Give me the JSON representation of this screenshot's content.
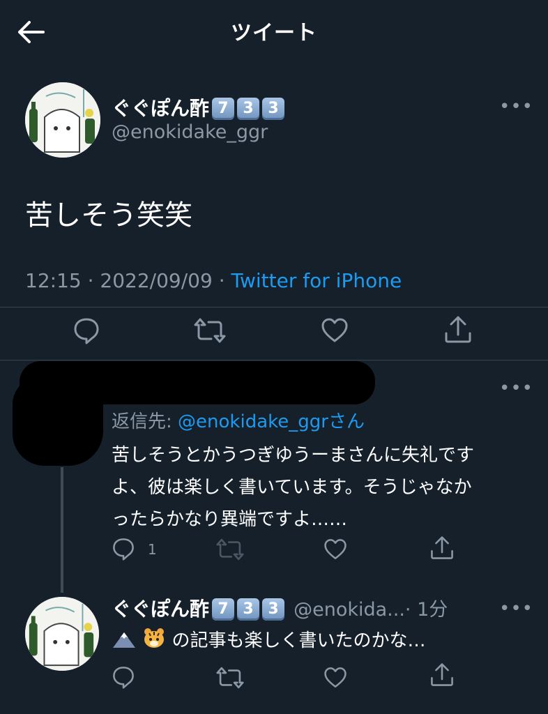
{
  "header": {
    "title": "ツイート"
  },
  "main_tweet": {
    "name": "ぐぐぽん酢",
    "badges": [
      "7",
      "3",
      "3"
    ],
    "handle": "@enokidake_ggr",
    "text": "苦しそう笑笑",
    "time": "12:15",
    "date": "2022/09/09",
    "separator": "·",
    "client": "Twitter for iPhone"
  },
  "reply": {
    "replying_prefix": "返信先:",
    "replying_handle": "@enokidake_ggr",
    "replying_suffix": "さん",
    "text_line1": "苦しそうとかうつぎゆうーまさんに失礼です",
    "text_line2": "よ、彼は楽しく書いています。そうじゃなか",
    "text_line3": "ったらかなり異端ですよ……",
    "reply_count": "1"
  },
  "thread_tweet": {
    "name": "ぐぐぽん酢",
    "badges": [
      "7",
      "3",
      "3"
    ],
    "handle": "@enokida...",
    "time": "· 1分",
    "text": "の記事も楽しく書いたのかな…"
  },
  "colors": {
    "background": "#15202b",
    "accent": "#1d9bf0",
    "muted": "#8b98a5",
    "divider": "#38444d"
  },
  "icons": [
    "back-arrow-icon",
    "more-icon",
    "reply-icon",
    "retweet-icon",
    "like-icon",
    "share-icon",
    "mountain-emoji-icon",
    "tiger-emoji-icon"
  ]
}
